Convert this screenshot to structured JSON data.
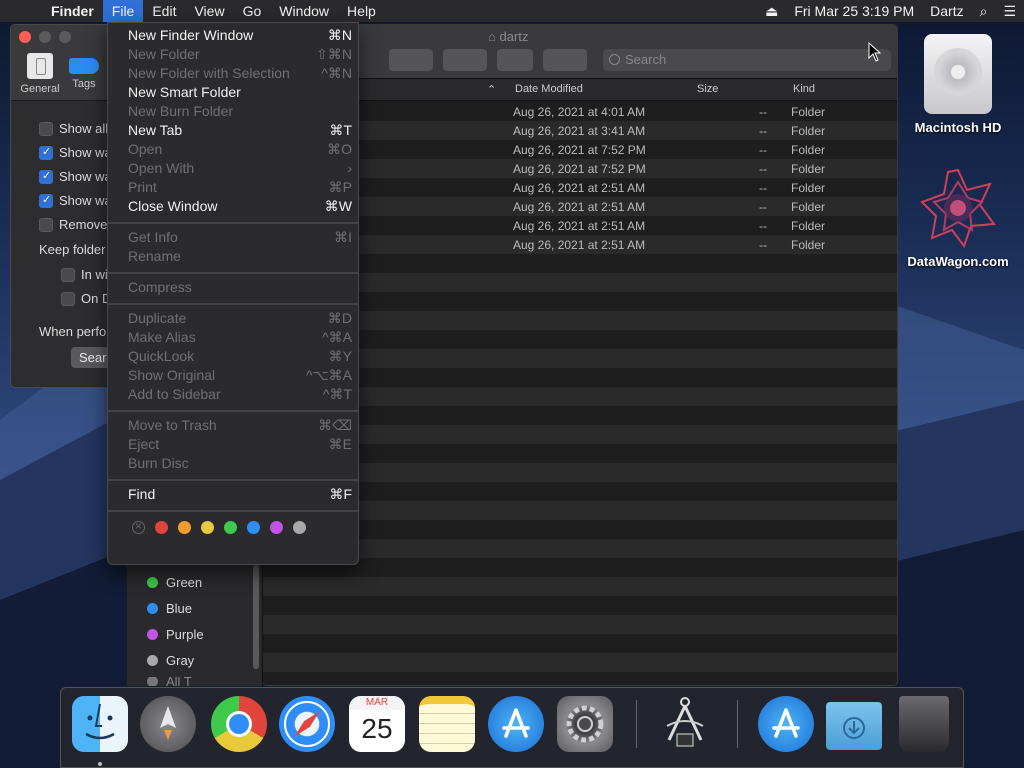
{
  "menubar": {
    "app": "Finder",
    "items": [
      "File",
      "Edit",
      "View",
      "Go",
      "Window",
      "Help"
    ],
    "datetime": "Fri Mar 25  3:19 PM",
    "user": "Dartz"
  },
  "prefs": {
    "tabs": [
      "General",
      "Tags"
    ],
    "checks": [
      {
        "label": "Show all",
        "checked": false
      },
      {
        "label": "Show wa",
        "checked": true
      },
      {
        "label": "Show wa",
        "checked": true
      },
      {
        "label": "Show wa",
        "checked": true
      },
      {
        "label": "Remove",
        "checked": false
      }
    ],
    "keep_label": "Keep folder",
    "sub_checks": [
      {
        "label": "In wi"
      },
      {
        "label": "On D"
      }
    ],
    "when_label": "When perfo",
    "search_btn": "Search"
  },
  "finder": {
    "title": "dartz",
    "search_placeholder": "Search",
    "columns": {
      "date": "Date Modified",
      "size": "Size",
      "kind": "Kind"
    },
    "rows": [
      {
        "date": "Aug 26, 2021 at 4:01 AM",
        "size": "--",
        "kind": "Folder"
      },
      {
        "date": "Aug 26, 2021 at 3:41 AM",
        "size": "--",
        "kind": "Folder"
      },
      {
        "date": "Aug 26, 2021 at 7:52 PM",
        "size": "--",
        "kind": "Folder"
      },
      {
        "date": "Aug 26, 2021 at 7:52 PM",
        "size": "--",
        "kind": "Folder"
      },
      {
        "date": "Aug 26, 2021 at 2:51 AM",
        "size": "--",
        "kind": "Folder"
      },
      {
        "date": "Aug 26, 2021 at 2:51 AM",
        "size": "--",
        "kind": "Folder"
      },
      {
        "date": "Aug 26, 2021 at 2:51 AM",
        "size": "--",
        "kind": "Folder"
      },
      {
        "date": "Aug 26, 2021 at 2:51 AM",
        "size": "--",
        "kind": "Folder"
      }
    ],
    "sidebar_tags": [
      {
        "label": "Green",
        "color": "#3dc94a"
      },
      {
        "label": "Blue",
        "color": "#2f8ef5"
      },
      {
        "label": "Purple",
        "color": "#c153e6"
      },
      {
        "label": "Gray",
        "color": "#a8a8aa"
      }
    ],
    "sidebar_partial": "All T"
  },
  "file_menu": {
    "items": [
      {
        "label": "New Finder Window",
        "shortcut": "⌘N",
        "enabled": true
      },
      {
        "label": "New Folder",
        "shortcut": "⇧⌘N",
        "enabled": false
      },
      {
        "label": "New Folder with Selection",
        "shortcut": "^⌘N",
        "enabled": false
      },
      {
        "label": "New Smart Folder",
        "shortcut": "",
        "enabled": true
      },
      {
        "label": "New Burn Folder",
        "shortcut": "",
        "enabled": false
      },
      {
        "label": "New Tab",
        "shortcut": "⌘T",
        "enabled": true
      },
      {
        "label": "Open",
        "shortcut": "⌘O",
        "enabled": false
      },
      {
        "label": "Open With",
        "shortcut": "",
        "enabled": false
      },
      {
        "label": "Print",
        "shortcut": "⌘P",
        "enabled": false
      },
      {
        "label": "Close Window",
        "shortcut": "⌘W",
        "enabled": true
      },
      {
        "label": "Get Info",
        "shortcut": "⌘I",
        "enabled": false
      },
      {
        "label": "Rename",
        "shortcut": "",
        "enabled": false
      },
      {
        "label": "Compress",
        "shortcut": "",
        "enabled": false
      },
      {
        "label": "Duplicate",
        "shortcut": "⌘D",
        "enabled": false
      },
      {
        "label": "Make Alias",
        "shortcut": "^⌘A",
        "enabled": false
      },
      {
        "label": "QuickLook",
        "shortcut": "⌘Y",
        "enabled": false
      },
      {
        "label": "Show Original",
        "shortcut": "^⌥⌘A",
        "enabled": false
      },
      {
        "label": "Add to Sidebar",
        "shortcut": "^⌘T",
        "enabled": false
      },
      {
        "label": "Move to Trash",
        "shortcut": "⌘⌫",
        "enabled": false
      },
      {
        "label": "Eject",
        "shortcut": "⌘E",
        "enabled": false
      },
      {
        "label": "Burn Disc",
        "shortcut": "",
        "enabled": false
      },
      {
        "label": "Find",
        "shortcut": "⌘F",
        "enabled": true
      }
    ],
    "tag_colors": [
      "#e0443c",
      "#f29b2e",
      "#e8c93a",
      "#3dc94a",
      "#2f8ef5",
      "#c153e6",
      "#a8a8aa"
    ]
  },
  "desktop": {
    "icons": [
      {
        "label": "Macintosh HD"
      },
      {
        "label": "DataWagon.com"
      }
    ]
  },
  "dock": {
    "calendar_month": "MAR",
    "calendar_day": "25",
    "apps": [
      "finder-icon",
      "launchpad-icon",
      "chrome-icon",
      "safari-icon",
      "calendar-icon",
      "notes-icon",
      "app-store-icon",
      "system-preferences-icon",
      "instruments-icon",
      "app-store-downloads-icon",
      "downloads-folder-icon",
      "trash-icon"
    ]
  }
}
